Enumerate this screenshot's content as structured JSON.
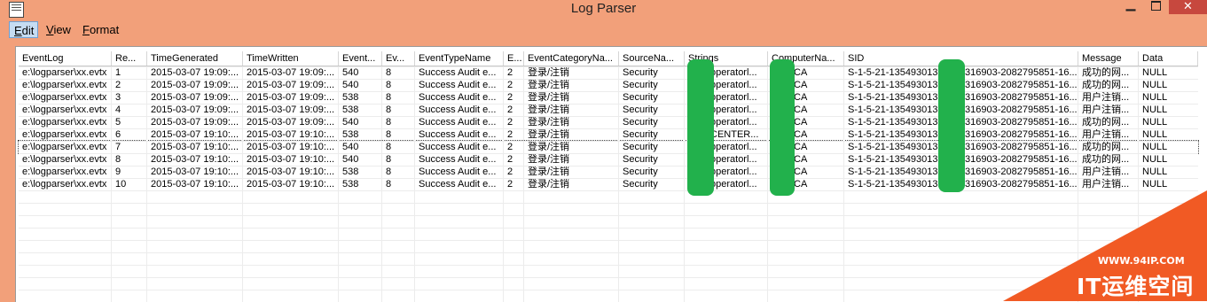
{
  "window": {
    "title": "Log Parser",
    "min_glyph": "▁",
    "close_glyph": "✕"
  },
  "menu": {
    "edit": {
      "mnemonic": "E",
      "rest": "dit"
    },
    "view": {
      "mnemonic": "V",
      "rest": "iew"
    },
    "format": {
      "mnemonic": "F",
      "rest": "ormat"
    }
  },
  "table": {
    "columns": [
      "EventLog",
      "Re...",
      "TimeGenerated",
      "TimeWritten",
      "Event...",
      "Ev...",
      "EventTypeName",
      "E...",
      "EventCategoryNa...",
      "SourceNa...",
      "Strings",
      "ComputerNa...",
      "SID",
      "Message",
      "Data"
    ],
    "rows": [
      [
        "e:\\logparser\\xx.evtx",
        "1",
        "2015-03-07 19:09:...",
        "2015-03-07 19:09:...",
        "540",
        "8",
        "Success Audit e...",
        "2",
        "登录/注销",
        "Security",
        "operatorl...",
        "CA",
        "S-1-5-21-1354930131",
        "316903-2082795851-16...",
        "成功的网...",
        "NULL"
      ],
      [
        "e:\\logparser\\xx.evtx",
        "2",
        "2015-03-07 19:09:...",
        "2015-03-07 19:09:...",
        "540",
        "8",
        "Success Audit e...",
        "2",
        "登录/注销",
        "Security",
        "operatorl...",
        "CA",
        "S-1-5-21-1354930131",
        "316903-2082795851-16...",
        "成功的网...",
        "NULL"
      ],
      [
        "e:\\logparser\\xx.evtx",
        "3",
        "2015-03-07 19:09:...",
        "2015-03-07 19:09:...",
        "538",
        "8",
        "Success Audit e...",
        "2",
        "登录/注销",
        "Security",
        "operatorl...",
        "CA",
        "S-1-5-21-1354930131",
        "316903-2082795851-16...",
        "用户注销...",
        "NULL"
      ],
      [
        "e:\\logparser\\xx.evtx",
        "4",
        "2015-03-07 19:09:...",
        "2015-03-07 19:09:...",
        "538",
        "8",
        "Success Audit e...",
        "2",
        "登录/注销",
        "Security",
        "operatorl...",
        "CA",
        "S-1-5-21-1354930131",
        "316903-2082795851-16...",
        "用户注销...",
        "NULL"
      ],
      [
        "e:\\logparser\\xx.evtx",
        "5",
        "2015-03-07 19:09:...",
        "2015-03-07 19:09:...",
        "540",
        "8",
        "Success Audit e...",
        "2",
        "登录/注销",
        "Security",
        "operatorl...",
        "CA",
        "S-1-5-21-1354930131",
        "316903-2082795851-16...",
        "成功的网...",
        "NULL"
      ],
      [
        "e:\\logparser\\xx.evtx",
        "6",
        "2015-03-07 19:10:...",
        "2015-03-07 19:10:...",
        "538",
        "8",
        "Success Audit e...",
        "2",
        "登录/注销",
        "Security",
        "CENTER...",
        "CA",
        "S-1-5-21-1354930131",
        "316903-2082795851-16...",
        "用户注销...",
        "NULL"
      ],
      [
        "e:\\logparser\\xx.evtx",
        "7",
        "2015-03-07 19:10:...",
        "2015-03-07 19:10:...",
        "540",
        "8",
        "Success Audit e...",
        "2",
        "登录/注销",
        "Security",
        "operatorl...",
        "CA",
        "S-1-5-21-1354930131",
        "316903-2082795851-16...",
        "成功的网...",
        "NULL"
      ],
      [
        "e:\\logparser\\xx.evtx",
        "8",
        "2015-03-07 19:10:...",
        "2015-03-07 19:10:...",
        "540",
        "8",
        "Success Audit e...",
        "2",
        "登录/注销",
        "Security",
        "operatorl...",
        "CA",
        "S-1-5-21-1354930131",
        "316903-2082795851-16...",
        "成功的网...",
        "NULL"
      ],
      [
        "e:\\logparser\\xx.evtx",
        "9",
        "2015-03-07 19:10:...",
        "2015-03-07 19:10:...",
        "538",
        "8",
        "Success Audit e...",
        "2",
        "登录/注销",
        "Security",
        "operatorl...",
        "CA",
        "S-1-5-21-1354930131",
        "316903-2082795851-16...",
        "用户注销...",
        "NULL"
      ],
      [
        "e:\\logparser\\xx.evtx",
        "10",
        "2015-03-07 19:10:...",
        "2015-03-07 19:10:...",
        "538",
        "8",
        "Success Audit e...",
        "2",
        "登录/注销",
        "Security",
        "operatorl...",
        "CA",
        "S-1-5-21-1354930131",
        "316903-2082795851-16...",
        "用户注销...",
        "NULL"
      ]
    ],
    "focused_row": 6
  },
  "watermark": {
    "url": "WWW.94IP.COM",
    "name": "IT运维空间"
  },
  "colors": {
    "title_bar": "#f2a07a",
    "close_button": "#c7483e",
    "redaction": "#22b14c",
    "watermark": "#f15a24"
  },
  "icons": [
    "app-icon",
    "minimize-icon",
    "maximize-icon",
    "close-icon"
  ]
}
